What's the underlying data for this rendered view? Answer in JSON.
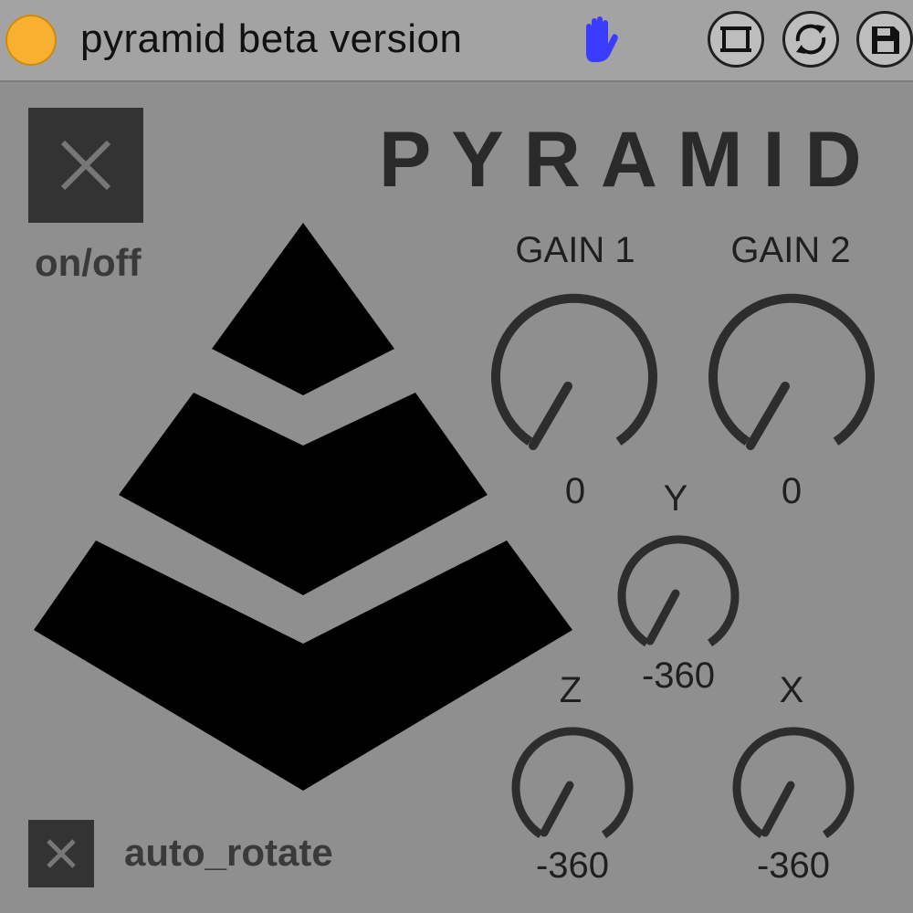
{
  "titlebar": {
    "title": "pyramid beta version",
    "status_color": "#f7b12e",
    "hand_icon": "hand-icon",
    "hand_color": "#3b3bff",
    "buttons": [
      {
        "icon": "freeze-icon"
      },
      {
        "icon": "refresh-icon"
      },
      {
        "icon": "save-icon"
      }
    ]
  },
  "device": {
    "brand": "PYRAMID",
    "onoff": {
      "label": "on/off",
      "state": "off"
    },
    "auto_rotate": {
      "label": "auto_rotate",
      "state": "off"
    },
    "knobs": {
      "gain1": {
        "label": "GAIN 1",
        "value": "0"
      },
      "gain2": {
        "label": "GAIN 2",
        "value": "0"
      },
      "y": {
        "label": "Y",
        "value": "-360"
      },
      "z": {
        "label": "Z",
        "value": "-360"
      },
      "x": {
        "label": "X",
        "value": "-360"
      }
    }
  }
}
